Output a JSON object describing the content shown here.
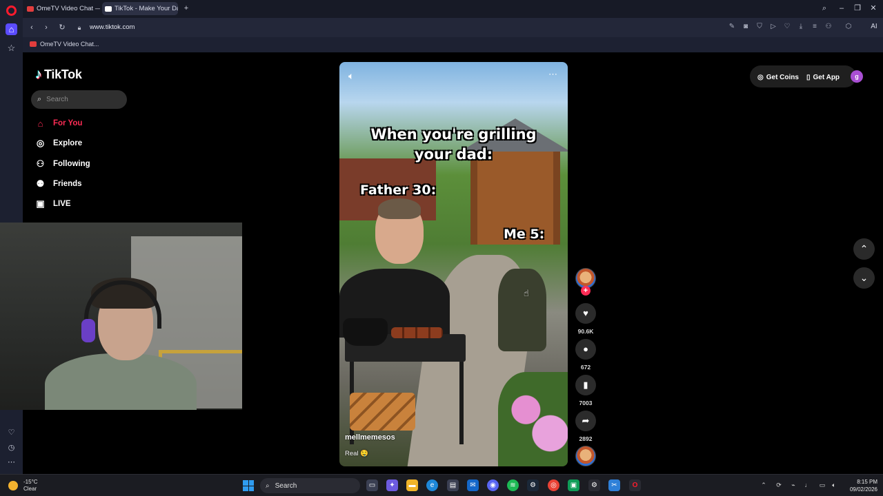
{
  "browser": {
    "tabs": [
      {
        "title": "OmeTV Video Chat — Or",
        "favicon_color": "#e23d3d"
      },
      {
        "title": "TikTok - Make Your Da",
        "favicon_color": "#ffffff"
      }
    ],
    "url": "www.tiktok.com",
    "bookmark": "OmeTV Video Chat...",
    "new_tab_symbol": "+",
    "ai_button": "AI"
  },
  "tiktok": {
    "brand": "TikTok",
    "search_placeholder": "Search",
    "nav": [
      {
        "label": "For You",
        "icon": "home-icon",
        "glyph": "⌂"
      },
      {
        "label": "Explore",
        "icon": "compass-icon",
        "glyph": "◎"
      },
      {
        "label": "Following",
        "icon": "user-follow-icon",
        "glyph": "⚇"
      },
      {
        "label": "Friends",
        "icon": "friends-icon",
        "glyph": "⚉"
      },
      {
        "label": "LIVE",
        "icon": "live-icon",
        "glyph": "▣"
      }
    ],
    "get_coins": "Get Coins",
    "get_app": "Get App",
    "profile_initial": "g",
    "video": {
      "caption_line1": "When you're grilling",
      "caption_line2": "your dad:",
      "label_father": "Father 30:",
      "label_me": "Me 5:",
      "author": "mellmemesos",
      "description": "Real 🤤"
    },
    "actions": {
      "likes": "90.6K",
      "comments": "672",
      "saves": "7003",
      "shares": "2892"
    },
    "accent_color": "#fe2c55"
  },
  "taskbar": {
    "weather_temp": "-15°C",
    "weather_desc": "Clear",
    "search_label": "Search",
    "time": "8:15 PM",
    "date": "09/02/2026"
  }
}
